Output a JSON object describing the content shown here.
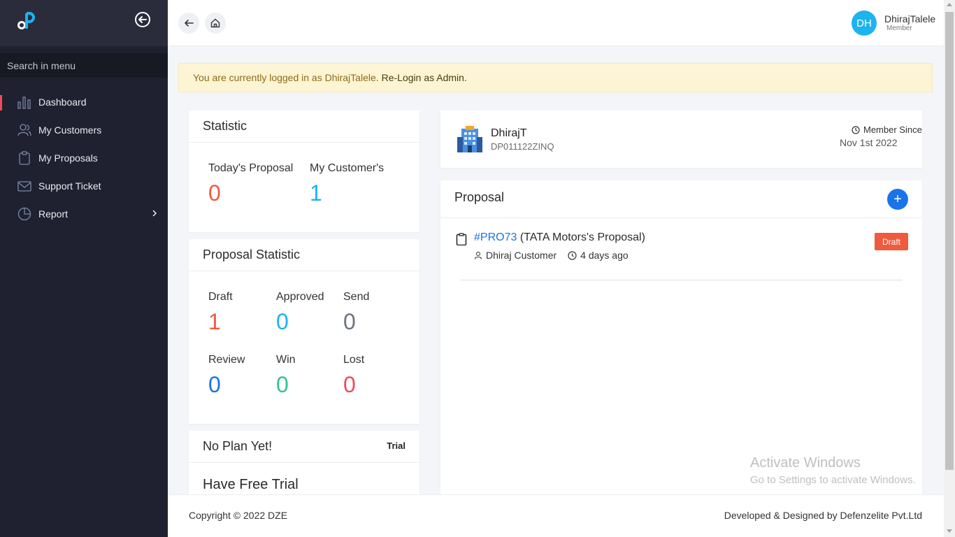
{
  "sidebar": {
    "logo_alt": "dP",
    "search_placeholder": "Search in menu",
    "items": [
      {
        "label": "Dashboard",
        "icon": "bar-chart-icon",
        "active": true
      },
      {
        "label": "My Customers",
        "icon": "users-icon"
      },
      {
        "label": "My Proposals",
        "icon": "clipboard-icon"
      },
      {
        "label": "Support Ticket",
        "icon": "mail-icon"
      },
      {
        "label": "Report",
        "icon": "pie-chart-icon",
        "has_submenu": true
      }
    ]
  },
  "topbar": {
    "avatar_initials": "DH",
    "user_name": "DhirajTalele",
    "user_role": "Member"
  },
  "alert": {
    "message": "You are currently logged in as DhirajTalele.",
    "action": "Re-Login as Admin."
  },
  "statistic": {
    "title": "Statistic",
    "todays_proposal_label": "Today's Proposal",
    "todays_proposal_value": "0",
    "customers_label": "My Customer's",
    "customers_value": "1"
  },
  "proposal_statistic": {
    "title": "Proposal Statistic",
    "items": [
      {
        "label": "Draft",
        "value": "1",
        "color": "#ef5a44"
      },
      {
        "label": "Approved",
        "value": "0",
        "color": "#1cb3ee"
      },
      {
        "label": "Send",
        "value": "0",
        "color": "#6b7480"
      },
      {
        "label": "Review",
        "value": "0",
        "color": "#1a73e8"
      },
      {
        "label": "Win",
        "value": "0",
        "color": "#34c38f"
      },
      {
        "label": "Lost",
        "value": "0",
        "color": "#ef4a5d"
      }
    ]
  },
  "plan": {
    "title": "No Plan Yet!",
    "badge": "Trial",
    "free_trial": "Have Free Trial"
  },
  "profile": {
    "name": "DhirajT",
    "code": "DP011122ZINQ",
    "member_since_label": "Member Since",
    "member_since_date": "Nov 1st 2022"
  },
  "proposal": {
    "title": "Proposal",
    "add_label": "+",
    "item": {
      "id": "#PRO73",
      "name": "(TATA Motors's Proposal)",
      "customer": "Dhiraj Customer",
      "time": "4 days ago",
      "status": "Draft"
    }
  },
  "watermark": {
    "line1": "Activate Windows",
    "line2": "Go to Settings to activate Windows."
  },
  "footer": {
    "copyright": "Copyright © 2022 DZE",
    "credit": "Developed & Designed by Defenzelite Pvt.Ltd"
  },
  "colors": {
    "sidebar_bg": "#1f2130",
    "accent_red": "#ef4a5d",
    "primary_blue": "#1a73e8",
    "cyan": "#1cb3ee",
    "draft_orange": "#f05a3e"
  }
}
